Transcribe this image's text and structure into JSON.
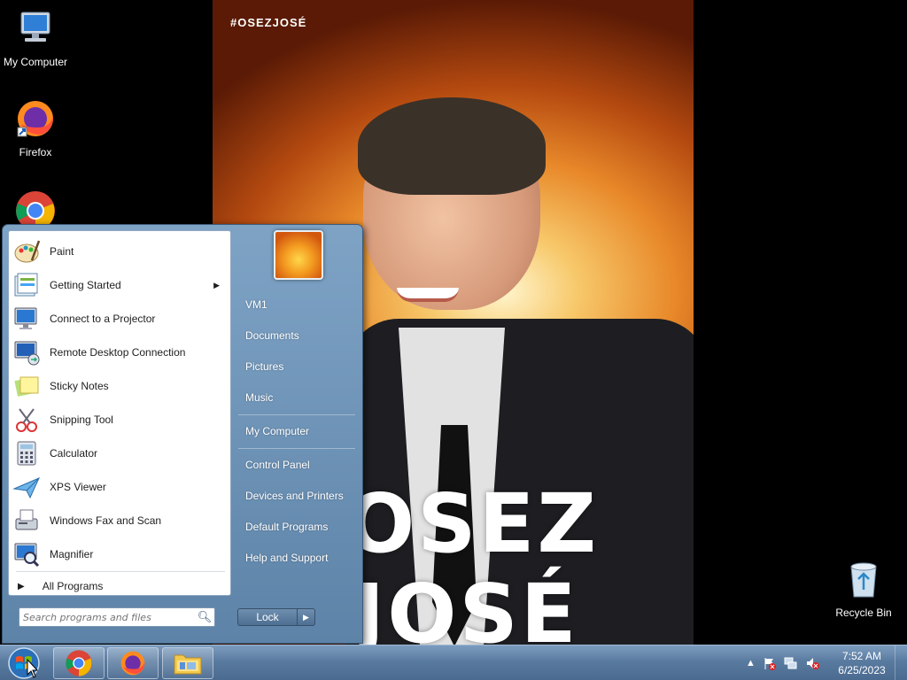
{
  "desktop": {
    "icons": [
      {
        "label": "My Computer",
        "icon": "computer-icon"
      },
      {
        "label": "Firefox",
        "icon": "firefox-icon"
      },
      {
        "label": "",
        "icon": "chrome-icon"
      },
      {
        "label": "Recycle Bin",
        "icon": "recycle-bin-icon"
      }
    ],
    "wallpaper": {
      "hashtag": "#OSEZJOSÉ",
      "line1": "OSEZ",
      "line2": "JOSÉ"
    }
  },
  "start_menu": {
    "programs": [
      {
        "label": "Paint",
        "icon": "paint-icon"
      },
      {
        "label": "Getting Started",
        "icon": "getting-started-icon",
        "has_submenu": true
      },
      {
        "label": "Connect to a Projector",
        "icon": "projector-icon"
      },
      {
        "label": "Remote Desktop Connection",
        "icon": "remote-desktop-icon"
      },
      {
        "label": "Sticky Notes",
        "icon": "sticky-notes-icon"
      },
      {
        "label": "Snipping Tool",
        "icon": "snipping-tool-icon"
      },
      {
        "label": "Calculator",
        "icon": "calculator-icon"
      },
      {
        "label": "XPS Viewer",
        "icon": "xps-viewer-icon"
      },
      {
        "label": "Windows Fax and Scan",
        "icon": "fax-scan-icon"
      },
      {
        "label": "Magnifier",
        "icon": "magnifier-icon"
      }
    ],
    "all_programs": "All Programs",
    "search_placeholder": "Search programs and files",
    "right_links": [
      "VM1",
      "Documents",
      "Pictures",
      "Music",
      "My Computer",
      "Control Panel",
      "Devices and Printers",
      "Default Programs",
      "Help and Support"
    ],
    "lock_label": "Lock"
  },
  "taskbar": {
    "pinned": [
      "chrome-icon",
      "firefox-icon",
      "explorer-icon"
    ],
    "clock_time": "7:52 AM",
    "clock_date": "6/25/2023"
  },
  "colors": {
    "taskbar": "#5a7ba0",
    "start_menu": "#6b8fb4"
  }
}
